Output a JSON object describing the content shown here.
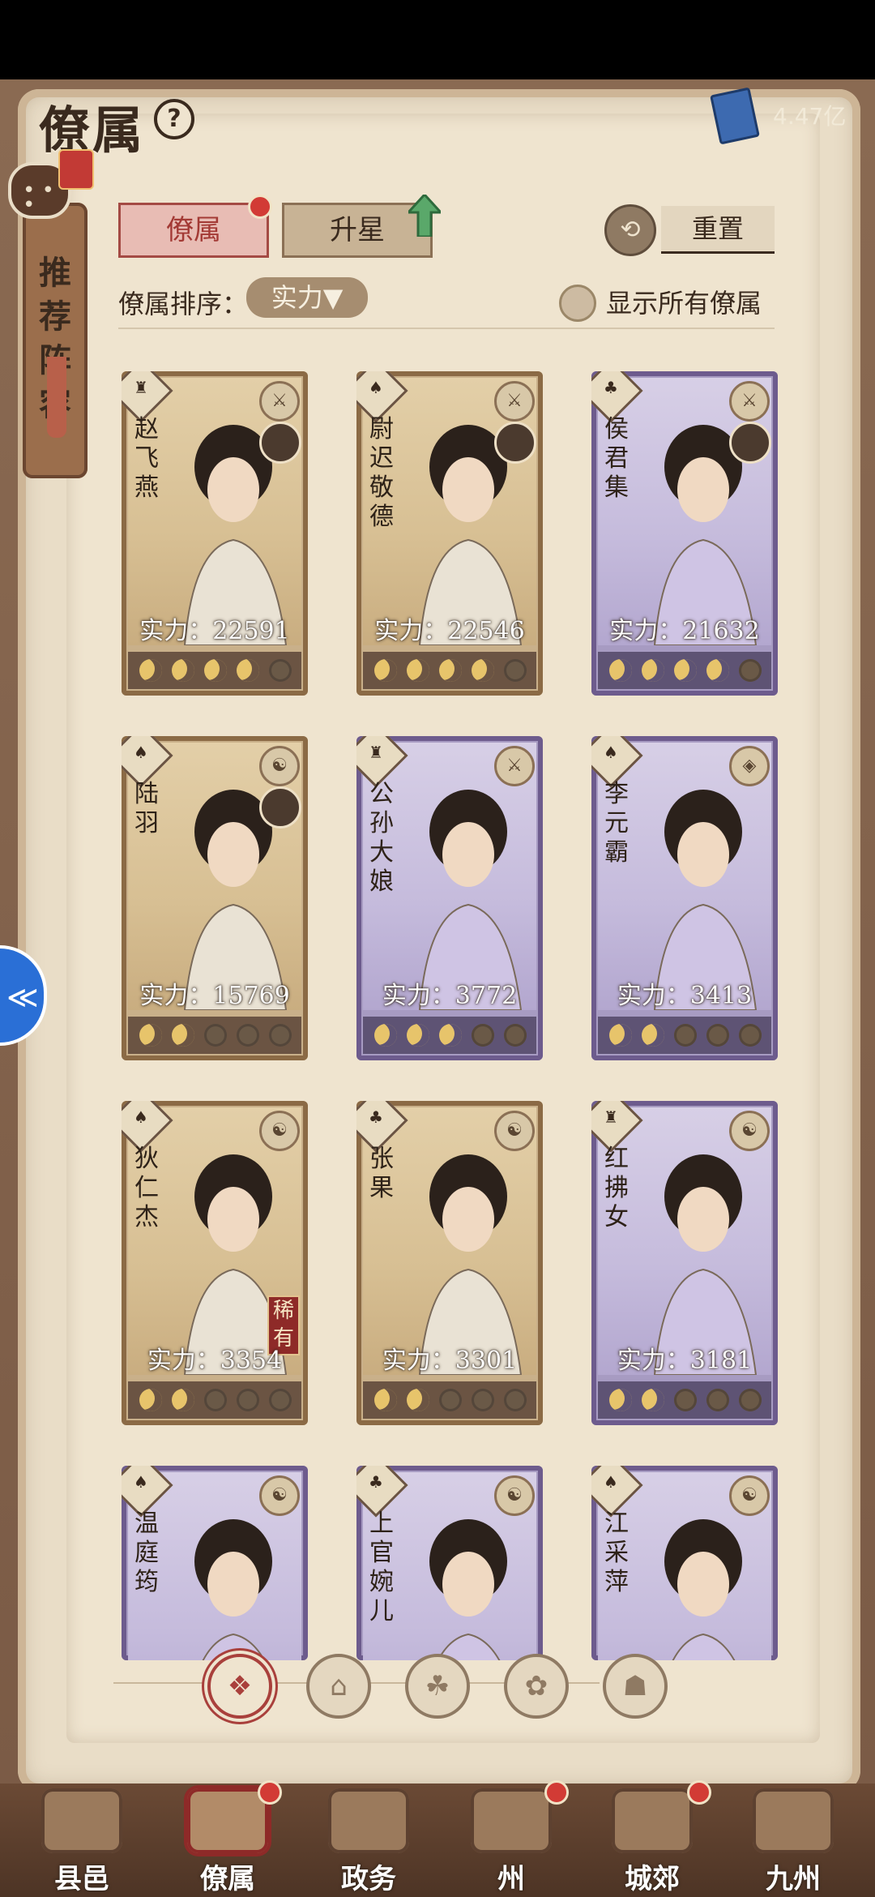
{
  "header": {
    "title": "僚属",
    "currency_value": "4.47亿"
  },
  "side_tab": {
    "label": "推荐阵容"
  },
  "tabs": [
    {
      "label": "僚属"
    },
    {
      "label": "升星"
    }
  ],
  "reset": {
    "label": "重置"
  },
  "sort": {
    "label": "僚属排序：",
    "selected": "实力▼"
  },
  "show_all": {
    "label": "显示所有僚属"
  },
  "cards": [
    {
      "name": "赵飞燕",
      "power": "实力：22591",
      "theme": "gold",
      "stars": 4
    },
    {
      "name": "尉迟敬德",
      "power": "实力：22546",
      "theme": "gold",
      "stars": 4
    },
    {
      "name": "侯君集",
      "power": "实力：21632",
      "theme": "purple",
      "stars": 4
    },
    {
      "name": "陆羽",
      "power": "实力：15769",
      "theme": "gold",
      "stars": 2
    },
    {
      "name": "公孙大娘",
      "power": "实力：3772",
      "theme": "purple",
      "stars": 3
    },
    {
      "name": "李元霸",
      "power": "实力：3413",
      "theme": "purple",
      "stars": 2
    },
    {
      "name": "狄仁杰",
      "power": "实力：3354",
      "theme": "gold",
      "stars": 2,
      "tag": "稀有"
    },
    {
      "name": "张果",
      "power": "实力：3301",
      "theme": "gold",
      "stars": 2
    },
    {
      "name": "红拂女",
      "power": "实力：3181",
      "theme": "purple",
      "stars": 2
    },
    {
      "name": "温庭筠",
      "power": "",
      "theme": "purple",
      "stars": 0
    },
    {
      "name": "上官婉儿",
      "power": "",
      "theme": "purple",
      "stars": 0
    },
    {
      "name": "江采萍",
      "power": "",
      "theme": "purple",
      "stars": 0
    }
  ],
  "bottom_nav": [
    {
      "label": "县邑"
    },
    {
      "label": "僚属"
    },
    {
      "label": "政务"
    },
    {
      "label": "州"
    },
    {
      "label": "城郊"
    },
    {
      "label": "九州"
    }
  ],
  "colors": {
    "accent_red": "#a9403c",
    "gold_card": "#c9b08a",
    "purple_card": "#a79bc2"
  }
}
